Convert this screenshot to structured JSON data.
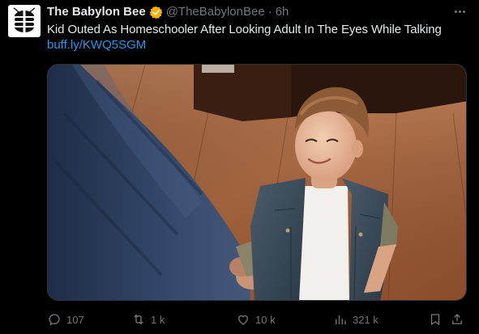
{
  "tweet": {
    "author": {
      "display_name": "The Babylon Bee",
      "handle": "@TheBabylonBee",
      "separator": "·",
      "time": "6h",
      "verified": true,
      "avatar_icon": "babylon-bee-logo-icon"
    },
    "text": "Kid Outed As Homeschooler After Looking Adult In The Eyes While Talking",
    "link": "buff.ly/KWQ5SGM",
    "media": {
      "kind": "photo",
      "icon": "photo-boy-shaking-hands-icon"
    },
    "actions": {
      "replies": "107",
      "retweets": "1 k",
      "likes": "10 k",
      "views": "321 k"
    }
  },
  "colors": {
    "background": "#000000",
    "text": "#e7e9ea",
    "muted": "#71767b",
    "link": "#1d9bf0",
    "verified_badge": "#f4b400",
    "border": "#2f3336"
  }
}
